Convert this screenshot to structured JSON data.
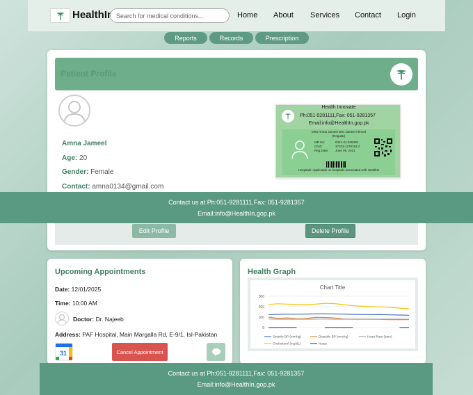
{
  "nav": {
    "brand": "HealthIn",
    "search_placeholder": "Search for medical conditions...",
    "links": [
      "Home",
      "About",
      "Services",
      "Contact",
      "Login"
    ]
  },
  "subnav": [
    "Reports",
    "Records",
    "Prescription"
  ],
  "profile": {
    "title": "Patient Profile",
    "name": "Amna Jameel",
    "age_label": "Age:",
    "age": "20",
    "gender_label": "Gender:",
    "gender": "Female",
    "contact_label": "Contact:",
    "contact": "amna0134@gmail.com",
    "edit_button": "Edit Profile",
    "delete_button": "Delete Profile"
  },
  "id_card": {
    "org": "Health Innovate",
    "phone": "Ph:051-9281111,Fax: 051-9281357",
    "email": "Email:info@HealthIn.gop.pk",
    "holder": "Miss Amna Jameel D/O Jameel Ahmed",
    "status": "(Regular)",
    "mr_label": "MR No:",
    "mr_value": "0421-21-045330",
    "cnic_label": "CNIC:",
    "cnic_value": "37203-1279153-2",
    "reg_label": "Reg.Date:",
    "reg_value": "June 09, 2021",
    "footer": "Hospitals: Applicable on hospitals associated with HealthIn"
  },
  "footer": {
    "line1": "Contact us at Ph:051-9281111,Fax: 051-9281357",
    "line2": "Email:info@HealthIn.gop.pk"
  },
  "appointments": {
    "title": "Upcoming Appointments",
    "date_label": "Date:",
    "date": "12/01/2025",
    "time_label": "Time:",
    "time": "10:00 AM",
    "doctor_label": "Doctor:",
    "doctor": "Dr. Najeeb",
    "address_label": "Address:",
    "address": "PAF Hospital, Main Margalla Rd, E-9/1, Isl-Pakistan",
    "cancel_button": "Cancel Appointment"
  },
  "graph": {
    "title": "Health Graph"
  },
  "chart_data": {
    "type": "line",
    "title": "Chart Title",
    "ylim": [
      0,
      300
    ],
    "yticks": [
      "0",
      "100",
      "200",
      "300"
    ],
    "x": [
      1,
      2,
      3,
      4,
      5,
      6,
      7,
      8,
      9,
      10,
      11,
      12,
      13,
      14,
      15,
      16
    ],
    "series": [
      {
        "name": "Systolic BP (mmHg)",
        "color": "#4472c4",
        "values": [
          125,
          127,
          128,
          128,
          129,
          131,
          132,
          130,
          129,
          127,
          126,
          125,
          124,
          122,
          120,
          118
        ]
      },
      {
        "name": "Diastolic BP (mmHg)",
        "color": "#ed7d31",
        "values": [
          100,
          88,
          92,
          85,
          86,
          98,
          97,
          92,
          82,
          80,
          80,
          80,
          78,
          76,
          76,
          77
        ]
      },
      {
        "name": "Heart Rate (bpm)",
        "color": "#a5a5a5",
        "values": [
          82,
          80,
          80,
          80,
          80,
          81,
          82,
          80,
          80,
          80,
          80,
          80,
          80,
          80,
          80,
          80
        ]
      },
      {
        "name": "Cholesterol (mg/dL)",
        "color": "#ffc000",
        "values": [
          222,
          228,
          225,
          221,
          220,
          224,
          232,
          230,
          219,
          210,
          204,
          200,
          198,
          193,
          186,
          180
        ]
      },
      {
        "name": "Notes",
        "color": "#255e91",
        "values": [
          0,
          0,
          0,
          0,
          null,
          null,
          0,
          0,
          0,
          0,
          null,
          null,
          null,
          null,
          0,
          0
        ]
      }
    ]
  }
}
